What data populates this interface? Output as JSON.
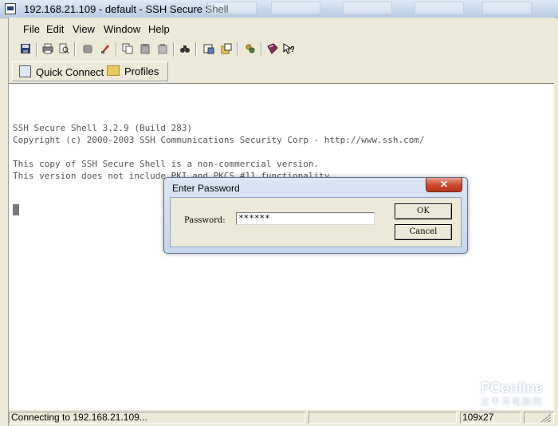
{
  "window": {
    "title": "192.168.21.109 - default - SSH Secure Shell"
  },
  "menu": [
    "File",
    "Edit",
    "View",
    "Window",
    "Help"
  ],
  "toolbar2": {
    "quick_connect": "Quick Connect",
    "profiles": "Profiles"
  },
  "terminal": {
    "lines": [
      "SSH Secure Shell 3.2.9 (Build 283)",
      "Copyright (c) 2000-2003 SSH Communications Security Corp - http://www.ssh.com/",
      "",
      "This copy of SSH Secure Shell is a non-commercial version.",
      "This version does not include PKI and PKCS #11 functionality."
    ]
  },
  "dialog": {
    "title": "Enter Password",
    "close_glyph": "✕",
    "password_label": "Password:",
    "password_value": "******",
    "ok_label": "OK",
    "cancel_label": "Cancel"
  },
  "status": {
    "message": "Connecting to 192.168.21.109...",
    "size": "109x27"
  },
  "watermark": {
    "brand": "PConline",
    "sub": "太平洋电脑网"
  },
  "icons": {
    "toolbar": [
      "save-icon",
      "print-icon",
      "print-preview-icon",
      "disconnect-icon",
      "copy-icon",
      "paste-icon",
      "paste-alt-icon",
      "find-icon",
      "settings-icon",
      "profile-settings-icon",
      "keys-icon",
      "help-book-icon",
      "whats-this-icon"
    ]
  }
}
